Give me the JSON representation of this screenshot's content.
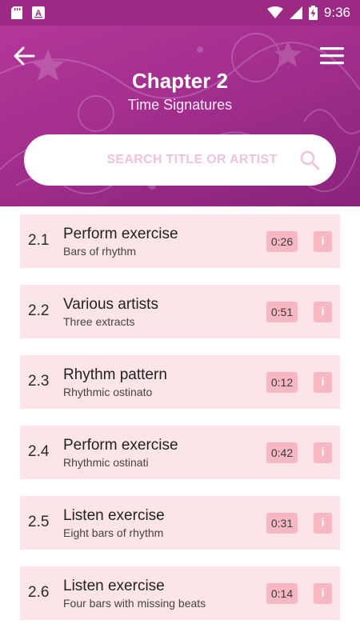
{
  "status_bar": {
    "time": "9:36",
    "icons": [
      "sd-card-icon",
      "a-box-icon",
      "wifi-icon",
      "signal-icon",
      "battery-charging-icon"
    ]
  },
  "header": {
    "title": "Chapter 2",
    "subtitle": "Time Signatures",
    "back_icon": "arrow-left-icon",
    "menu_icon": "hamburger-menu-icon"
  },
  "search": {
    "placeholder": "SEARCH TITLE OR ARTIST",
    "icon": "search-icon"
  },
  "tracks": [
    {
      "number": "2.1",
      "title": "Perform exercise",
      "subtitle": "Bars of rhythm",
      "duration": "0:26",
      "info": "i"
    },
    {
      "number": "2.2",
      "title": "Various artists",
      "subtitle": "Three extracts",
      "duration": "0:51",
      "info": "i"
    },
    {
      "number": "2.3",
      "title": "Rhythm pattern",
      "subtitle": "Rhythmic ostinato",
      "duration": "0:12",
      "info": "i"
    },
    {
      "number": "2.4",
      "title": "Perform exercise",
      "subtitle": "Rhythmic ostinati",
      "duration": "0:42",
      "info": "i"
    },
    {
      "number": "2.5",
      "title": "Listen exercise",
      "subtitle": "Eight bars of rhythm",
      "duration": "0:31",
      "info": "i"
    },
    {
      "number": "2.6",
      "title": "Listen exercise",
      "subtitle": "Four bars with missing beats",
      "duration": "0:14",
      "info": "i"
    }
  ],
  "colors": {
    "header": "#a22e8e",
    "status_bar": "#9c2a84",
    "item_background": "#fde4e8",
    "badge_background": "#f7b7c3"
  }
}
